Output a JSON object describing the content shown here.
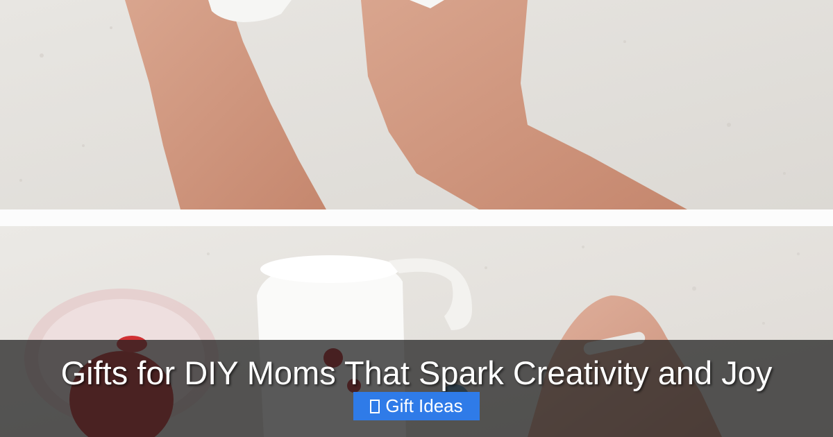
{
  "caption": {
    "title": "Gifts for DIY Moms That Spark Creativity and Joy",
    "category_label": "Gift Ideas",
    "category_icon": "tag-icon"
  },
  "colors": {
    "badge_background": "#2f7be8",
    "caption_background": "#202020",
    "divider": "#fcfcfc"
  }
}
